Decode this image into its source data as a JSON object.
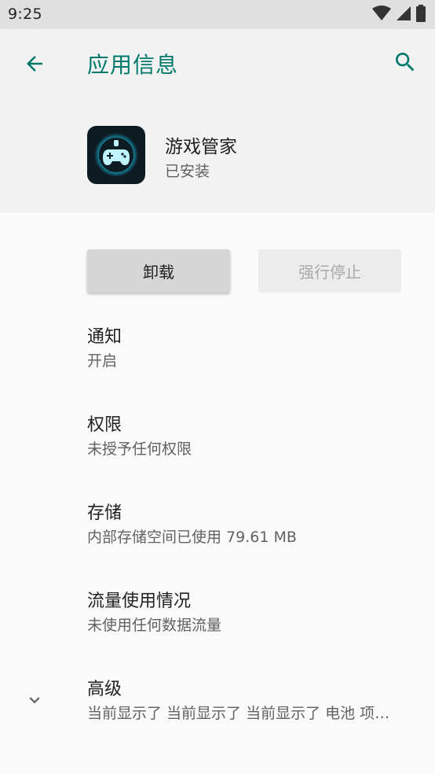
{
  "status_bar": {
    "time": "9:25",
    "icons": [
      "wifi-icon",
      "signal-icon",
      "battery-icon"
    ]
  },
  "toolbar": {
    "title": "应用信息",
    "back_icon": "arrow-left-icon",
    "search_icon": "search-icon",
    "accent_color": "#00796b"
  },
  "app": {
    "name": "游戏管家",
    "status": "已安装",
    "icon": "gamepad-icon"
  },
  "actions": {
    "uninstall_label": "卸载",
    "force_stop_label": "强行停止"
  },
  "settings": [
    {
      "title": "通知",
      "subtitle": "开启"
    },
    {
      "title": "权限",
      "subtitle": "未授予任何权限"
    },
    {
      "title": "存储",
      "subtitle": "内部存储空间已使用 79.61 MB"
    },
    {
      "title": "流量使用情况",
      "subtitle": "未使用任何数据流量"
    },
    {
      "title": "高级",
      "subtitle": "当前显示了 当前显示了 当前显示了 电池 项…"
    }
  ]
}
